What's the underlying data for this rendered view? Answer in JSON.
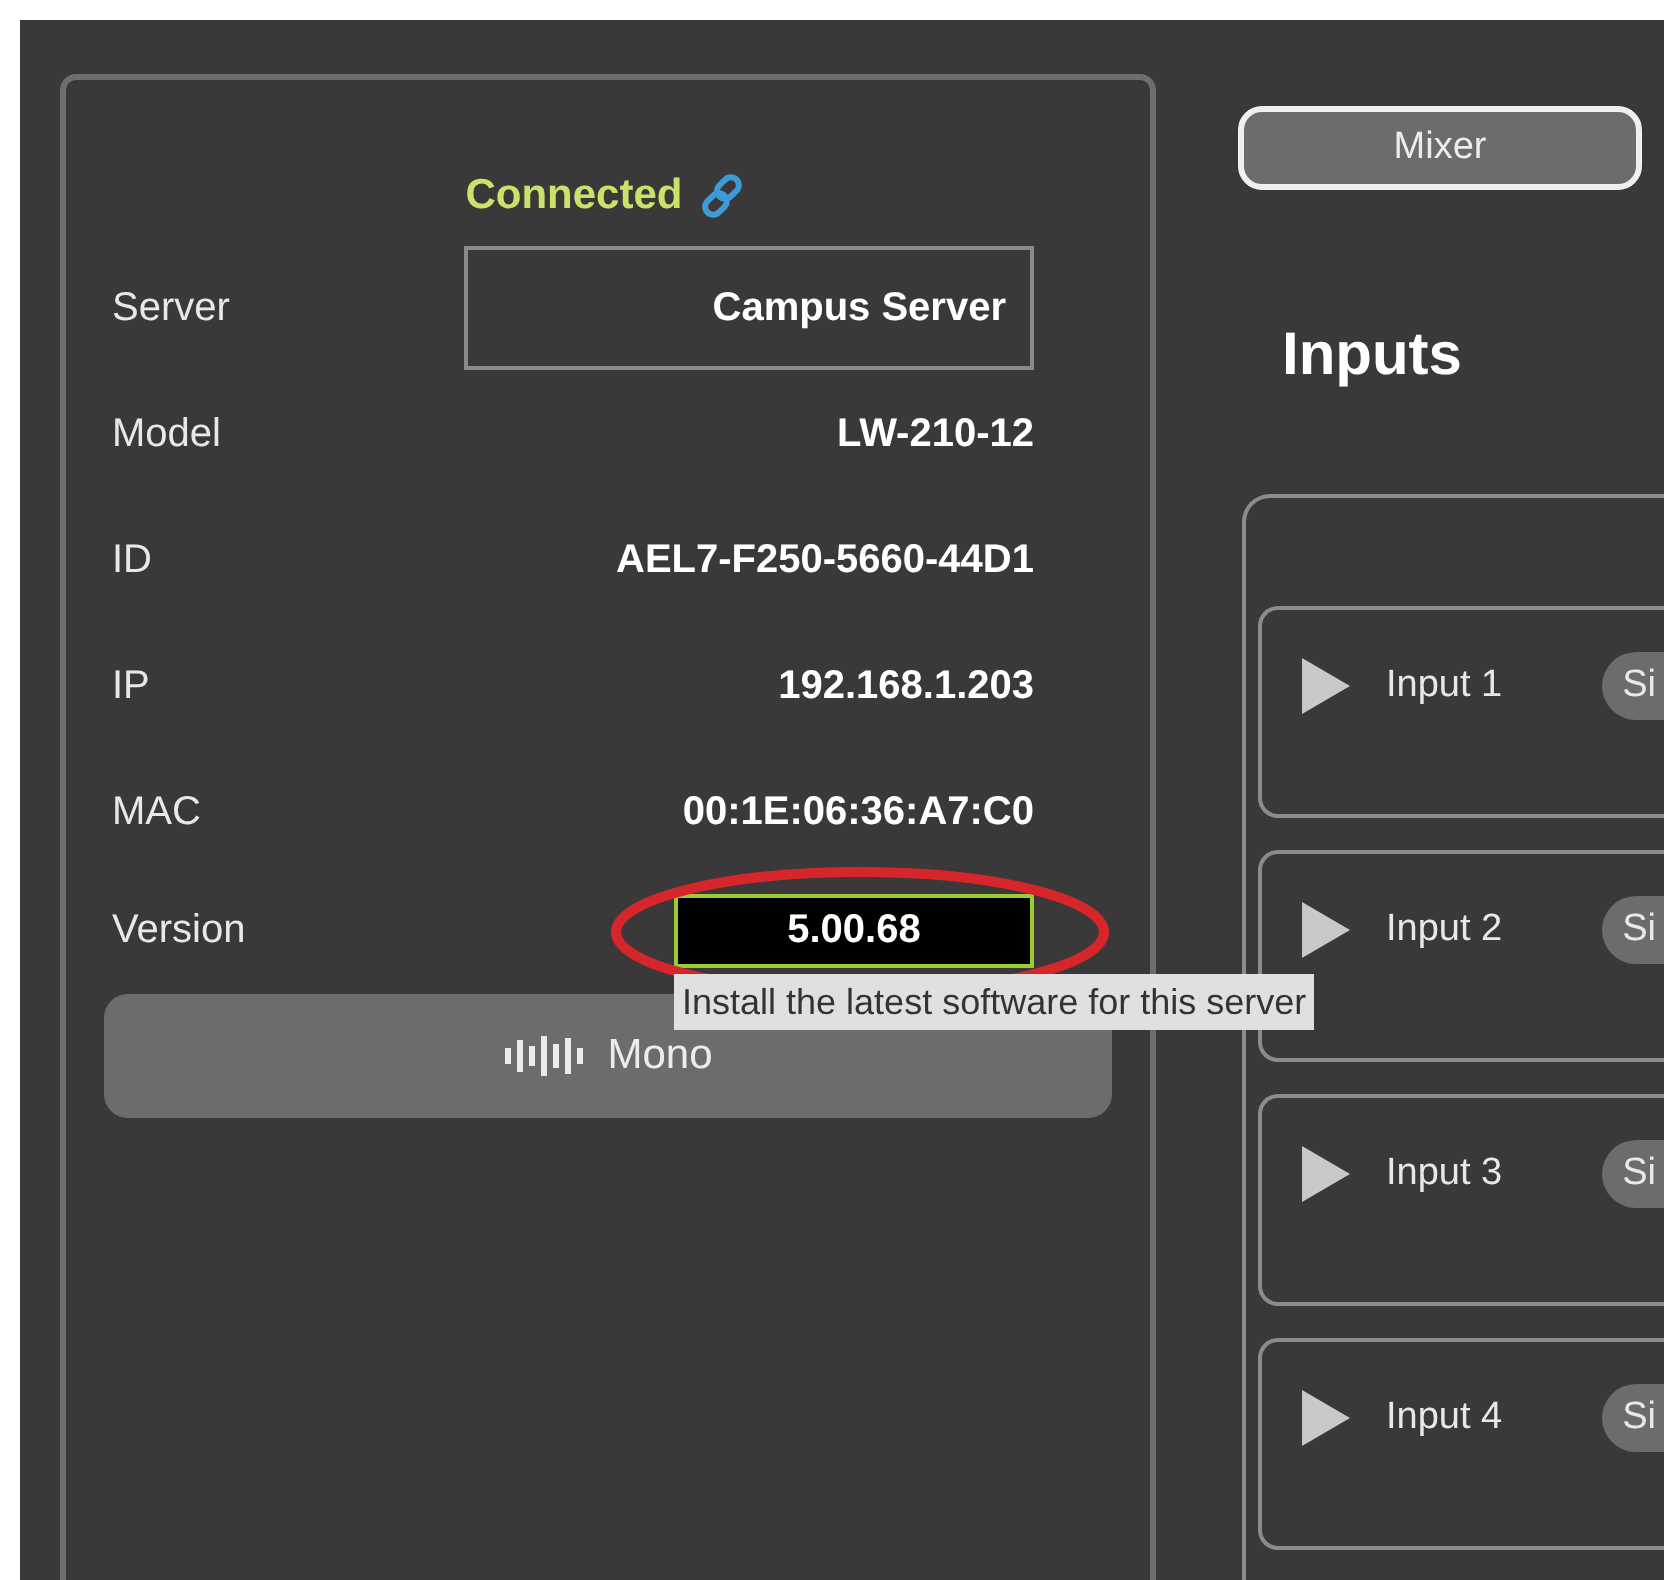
{
  "status": {
    "text": "Connected",
    "connected": true
  },
  "fields": [
    {
      "kind": "box",
      "label": "Server",
      "value": "Campus Server"
    },
    {
      "kind": "plain",
      "label": "Model",
      "value": "LW-210-12"
    },
    {
      "kind": "plain",
      "label": "ID",
      "value": "AEL7-F250-5660-44D1"
    },
    {
      "kind": "plain",
      "label": "IP",
      "value": "192.168.1.203"
    },
    {
      "kind": "plain",
      "label": "MAC",
      "value": "00:1E:06:36:A7:C0"
    },
    {
      "kind": "update",
      "label": "Version",
      "value": "5.00.68",
      "tooltip": "Install the latest software for this server"
    }
  ],
  "mono_button": {
    "label": "Mono"
  },
  "mixer_button": {
    "label": "Mixer"
  },
  "inputs": {
    "title": "Inputs",
    "rows": [
      {
        "name": "Input 1",
        "expanded": false,
        "button": "Si"
      },
      {
        "name": "Input 2",
        "expanded": false,
        "button": "Si"
      },
      {
        "name": "Input 3",
        "expanded": false,
        "button": "Si"
      },
      {
        "name": "Input 4",
        "expanded": false,
        "button": "Si"
      }
    ]
  }
}
